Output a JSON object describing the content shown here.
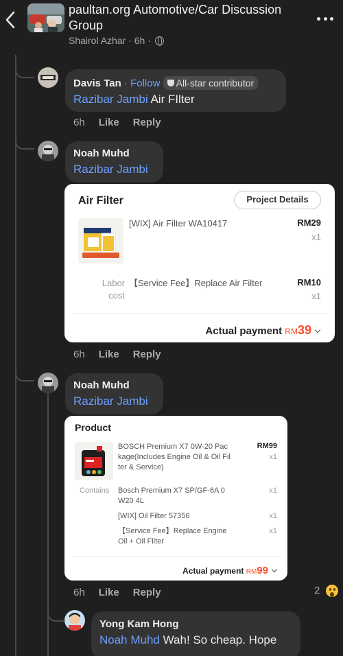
{
  "header": {
    "title": "paultan.org Automotive/Car Discussion Group",
    "author": "Shairol Azhar",
    "time": "6h",
    "dot": "·"
  },
  "comments": [
    {
      "name": "Davis Tan",
      "follow": "Follow",
      "badge": "All-star contributor",
      "mention": "Razibar Jambi",
      "text": "Air FIlter",
      "time": "6h",
      "like": "Like",
      "reply": "Reply"
    },
    {
      "name": "Noah Muhd",
      "mention": "Razibar Jambi",
      "time": "6h",
      "like": "Like",
      "reply": "Reply"
    },
    {
      "name": "Noah Muhd",
      "mention": "Razibar Jambi",
      "time": "6h",
      "like": "Like",
      "reply": "Reply",
      "reaction_count": "2"
    },
    {
      "name": "Yong Kam Hong",
      "mention": "Noah Muhd",
      "text": "Wah! So cheap. Hope"
    }
  ],
  "card1": {
    "title": "Air Filter",
    "button": "Project Details",
    "item_name": "[WIX] Air Filter WA10417",
    "item_price": "RM29",
    "item_qty": "x1",
    "labor_label_1": "Labor",
    "labor_label_2": "cost",
    "service_name": "【Service Fee】Replace Air Filter",
    "service_price": "RM10",
    "service_qty": "x1",
    "payment_label": "Actual payment",
    "currency": "RM",
    "amount": "39"
  },
  "card2": {
    "title": "Product",
    "item_name": "BOSCH Premium X7 0W-20 Package(Includes Engine Oil & Oil Filter & Service)",
    "item_name_l1": "BOSCH Premium X7 0W-20 Pac",
    "item_name_l2": "kage(Includes Engine Oil & Oil Fil",
    "item_name_l3": "ter & Service)",
    "item_price": "RM99",
    "item_qty": "x1",
    "contains_label": "Contains",
    "sub1_l1": "Bosch Premium X7 SP/GF-6A 0",
    "sub1_l2": "W20 4L",
    "sub1_qty": "x1",
    "sub2": "[WIX] Oil Filter 57356",
    "sub2_qty": "x1",
    "sub3_l1": "【Service Fee】Replace Engine",
    "sub3_l2": "Oil + Oil Filter",
    "sub3_qty": "x1",
    "payment_label": "Actual payment",
    "currency": "RM",
    "amount": "99"
  },
  "colors": {
    "background": "#1f1f1f",
    "bubble": "#333334",
    "mention": "#6ea0ff",
    "price_accent": "#ff4d2e"
  }
}
